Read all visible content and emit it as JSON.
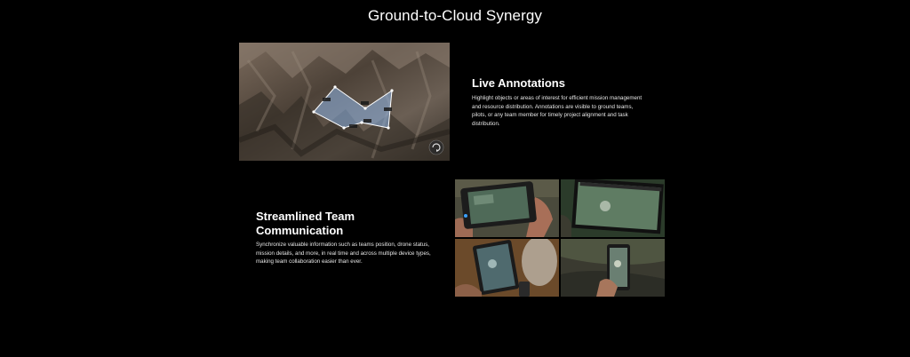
{
  "page": {
    "title": "Ground-to-Cloud Synergy"
  },
  "live_annotations": {
    "heading": "Live Annotations",
    "description": "Highlight objects or areas of interest for efficient mission management and resource distribution. Annotations are visible to ground teams, pilots, or any team member for timely project alignment and task distribution."
  },
  "team_communication": {
    "heading": "Streamlined Team Communication",
    "description": "Synchronize valuable information such as teams position, drone status, mission details, and more, in real time and across multiple device types, making team collaboration easier than ever."
  },
  "icons": {
    "map_control": "rotate-icon"
  },
  "colors": {
    "background": "#000000",
    "annotation_fill": "#8fb6e8",
    "text": "#ffffff"
  }
}
